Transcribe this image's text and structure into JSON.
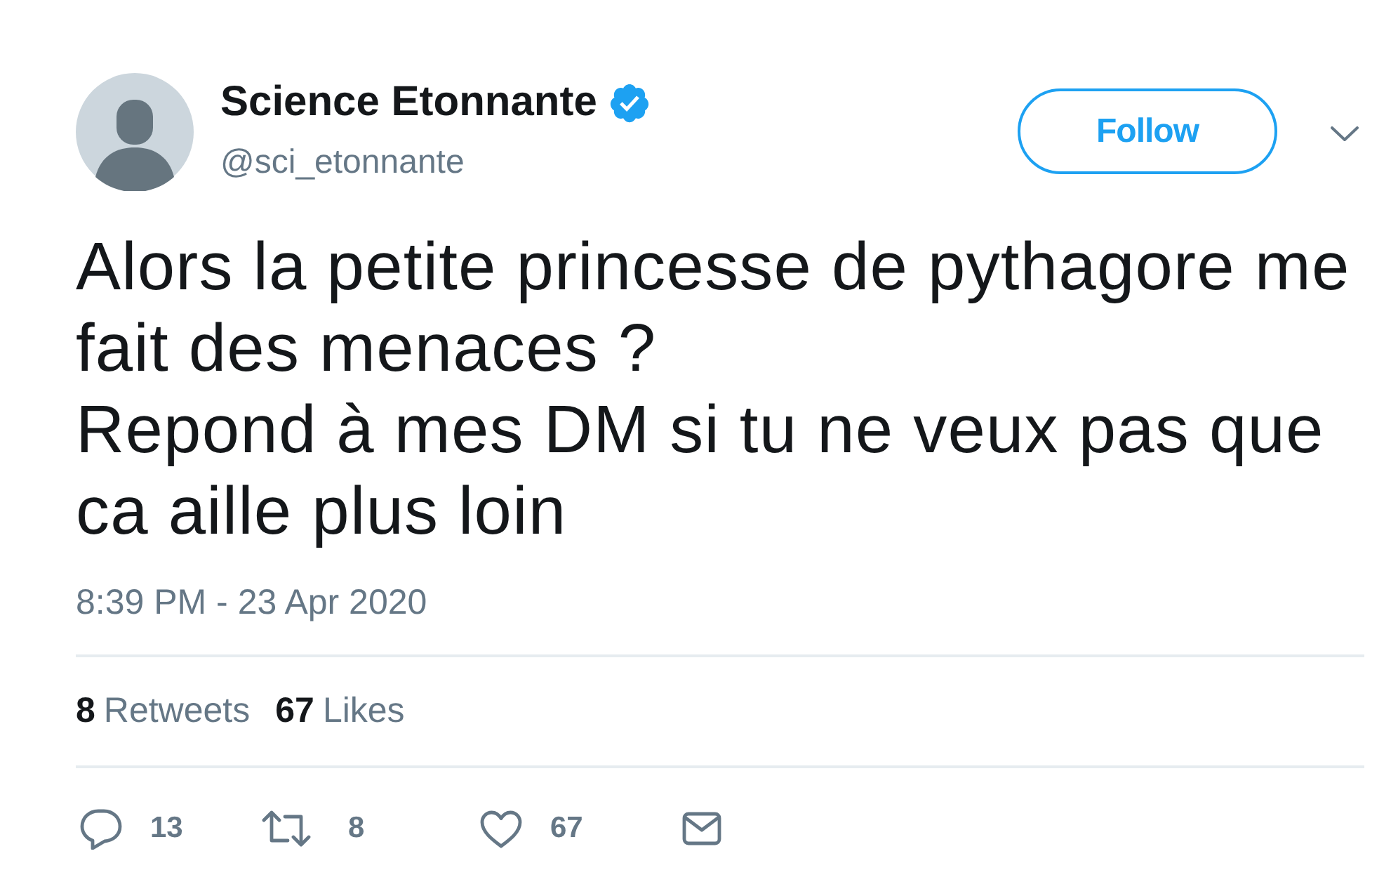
{
  "author": {
    "name": "Science Etonnante",
    "verified": true,
    "handle": "@sci_etonnante"
  },
  "follow_button": "Follow",
  "text": [
    "Alors la petite princesse de pythagore me fait des menaces ?",
    "Repond à mes DM si tu ne veux pas que ca aille plus loin"
  ],
  "timestamp": "8:39 PM - 23 Apr 2020",
  "stats": [
    {
      "count": "8",
      "label": "Retweets"
    },
    {
      "count": "67",
      "label": "Likes"
    }
  ],
  "actions": [
    {
      "kind": "reply",
      "count": "13"
    },
    {
      "kind": "retweet",
      "count": "8"
    },
    {
      "kind": "like",
      "count": "67"
    },
    {
      "kind": "message"
    }
  ]
}
